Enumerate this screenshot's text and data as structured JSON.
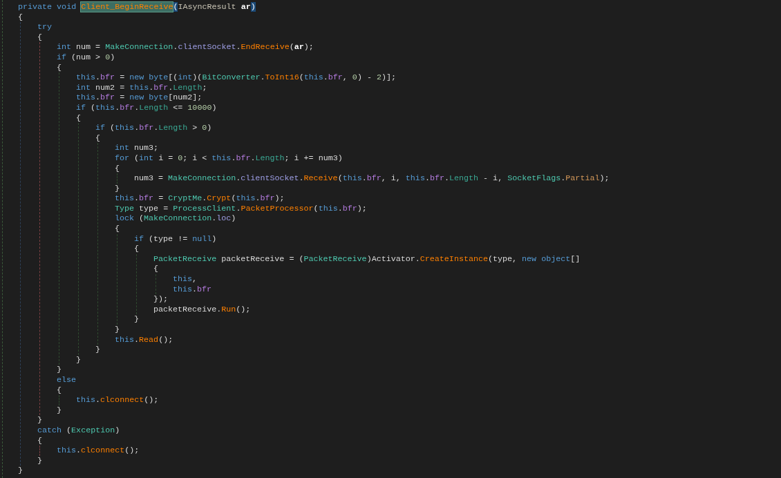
{
  "editor": {
    "code": [
      {
        "kind": "line",
        "tokens": [
          {
            "kind": "kw",
            "text": "private void "
          },
          {
            "kind": "hl",
            "text": "Client_BeginReceive"
          },
          {
            "kind": "match",
            "text": "("
          },
          {
            "kind": "iface",
            "text": "IAsyncResult "
          },
          {
            "kind": "param",
            "text": "ar"
          },
          {
            "kind": "match",
            "text": ")"
          }
        ]
      },
      {
        "kind": "line",
        "tokens": [
          {
            "kind": "plain",
            "text": "{"
          }
        ]
      },
      {
        "kind": "block",
        "children": [
          {
            "kind": "line",
            "tokens": [
              {
                "kind": "kw",
                "text": "try"
              }
            ]
          },
          {
            "kind": "line",
            "tokens": [
              {
                "kind": "plain",
                "text": "{"
              }
            ]
          },
          {
            "kind": "block",
            "children": [
              {
                "kind": "line",
                "tokens": [
                  {
                    "kind": "kw",
                    "text": "int "
                  },
                  {
                    "kind": "plain",
                    "text": "num = "
                  },
                  {
                    "kind": "type",
                    "text": "MakeConnection"
                  },
                  {
                    "kind": "plain",
                    "text": "."
                  },
                  {
                    "kind": "member",
                    "text": "clientSocket"
                  },
                  {
                    "kind": "plain",
                    "text": "."
                  },
                  {
                    "kind": "method",
                    "text": "EndReceive"
                  },
                  {
                    "kind": "plain",
                    "text": "("
                  },
                  {
                    "kind": "param",
                    "text": "ar"
                  },
                  {
                    "kind": "plain",
                    "text": ");"
                  }
                ]
              },
              {
                "kind": "line",
                "tokens": [
                  {
                    "kind": "kw",
                    "text": "if "
                  },
                  {
                    "kind": "plain",
                    "text": "(num > "
                  },
                  {
                    "kind": "num",
                    "text": "0"
                  },
                  {
                    "kind": "plain",
                    "text": ")"
                  }
                ]
              },
              {
                "kind": "line",
                "tokens": [
                  {
                    "kind": "plain",
                    "text": "{"
                  }
                ]
              },
              {
                "kind": "block",
                "children": [
                  {
                    "kind": "line",
                    "tokens": [
                      {
                        "kind": "kw",
                        "text": "this"
                      },
                      {
                        "kind": "plain",
                        "text": "."
                      },
                      {
                        "kind": "field",
                        "text": "bfr"
                      },
                      {
                        "kind": "plain",
                        "text": " = "
                      },
                      {
                        "kind": "kw",
                        "text": "new byte"
                      },
                      {
                        "kind": "plain",
                        "text": "[("
                      },
                      {
                        "kind": "kw",
                        "text": "int"
                      },
                      {
                        "kind": "plain",
                        "text": ")("
                      },
                      {
                        "kind": "type",
                        "text": "BitConverter"
                      },
                      {
                        "kind": "plain",
                        "text": "."
                      },
                      {
                        "kind": "method",
                        "text": "ToInt16"
                      },
                      {
                        "kind": "plain",
                        "text": "("
                      },
                      {
                        "kind": "kw",
                        "text": "this"
                      },
                      {
                        "kind": "plain",
                        "text": "."
                      },
                      {
                        "kind": "field",
                        "text": "bfr"
                      },
                      {
                        "kind": "plain",
                        "text": ", "
                      },
                      {
                        "kind": "num",
                        "text": "0"
                      },
                      {
                        "kind": "plain",
                        "text": ") - "
                      },
                      {
                        "kind": "num",
                        "text": "2"
                      },
                      {
                        "kind": "plain",
                        "text": ")];"
                      }
                    ]
                  },
                  {
                    "kind": "line",
                    "tokens": [
                      {
                        "kind": "kw",
                        "text": "int "
                      },
                      {
                        "kind": "plain",
                        "text": "num2 = "
                      },
                      {
                        "kind": "kw",
                        "text": "this"
                      },
                      {
                        "kind": "plain",
                        "text": "."
                      },
                      {
                        "kind": "field",
                        "text": "bfr"
                      },
                      {
                        "kind": "plain",
                        "text": "."
                      },
                      {
                        "kind": "prop",
                        "text": "Length"
                      },
                      {
                        "kind": "plain",
                        "text": ";"
                      }
                    ]
                  },
                  {
                    "kind": "line",
                    "tokens": [
                      {
                        "kind": "kw",
                        "text": "this"
                      },
                      {
                        "kind": "plain",
                        "text": "."
                      },
                      {
                        "kind": "field",
                        "text": "bfr"
                      },
                      {
                        "kind": "plain",
                        "text": " = "
                      },
                      {
                        "kind": "kw",
                        "text": "new byte"
                      },
                      {
                        "kind": "plain",
                        "text": "[num2];"
                      }
                    ]
                  },
                  {
                    "kind": "line",
                    "tokens": [
                      {
                        "kind": "kw",
                        "text": "if "
                      },
                      {
                        "kind": "plain",
                        "text": "("
                      },
                      {
                        "kind": "kw",
                        "text": "this"
                      },
                      {
                        "kind": "plain",
                        "text": "."
                      },
                      {
                        "kind": "field",
                        "text": "bfr"
                      },
                      {
                        "kind": "plain",
                        "text": "."
                      },
                      {
                        "kind": "prop",
                        "text": "Length"
                      },
                      {
                        "kind": "plain",
                        "text": " <= "
                      },
                      {
                        "kind": "num",
                        "text": "10000"
                      },
                      {
                        "kind": "plain",
                        "text": ")"
                      }
                    ]
                  },
                  {
                    "kind": "line",
                    "tokens": [
                      {
                        "kind": "plain",
                        "text": "{"
                      }
                    ]
                  },
                  {
                    "kind": "block",
                    "children": [
                      {
                        "kind": "line",
                        "tokens": [
                          {
                            "kind": "kw",
                            "text": "if "
                          },
                          {
                            "kind": "plain",
                            "text": "("
                          },
                          {
                            "kind": "kw",
                            "text": "this"
                          },
                          {
                            "kind": "plain",
                            "text": "."
                          },
                          {
                            "kind": "field",
                            "text": "bfr"
                          },
                          {
                            "kind": "plain",
                            "text": "."
                          },
                          {
                            "kind": "prop",
                            "text": "Length"
                          },
                          {
                            "kind": "plain",
                            "text": " > "
                          },
                          {
                            "kind": "num",
                            "text": "0"
                          },
                          {
                            "kind": "plain",
                            "text": ")"
                          }
                        ]
                      },
                      {
                        "kind": "line",
                        "tokens": [
                          {
                            "kind": "plain",
                            "text": "{"
                          }
                        ]
                      },
                      {
                        "kind": "block",
                        "children": [
                          {
                            "kind": "line",
                            "tokens": [
                              {
                                "kind": "kw",
                                "text": "int "
                              },
                              {
                                "kind": "plain",
                                "text": "num3;"
                              }
                            ]
                          },
                          {
                            "kind": "line",
                            "tokens": [
                              {
                                "kind": "kw",
                                "text": "for "
                              },
                              {
                                "kind": "plain",
                                "text": "("
                              },
                              {
                                "kind": "kw",
                                "text": "int "
                              },
                              {
                                "kind": "plain",
                                "text": "i = "
                              },
                              {
                                "kind": "num",
                                "text": "0"
                              },
                              {
                                "kind": "plain",
                                "text": "; i < "
                              },
                              {
                                "kind": "kw",
                                "text": "this"
                              },
                              {
                                "kind": "plain",
                                "text": "."
                              },
                              {
                                "kind": "field",
                                "text": "bfr"
                              },
                              {
                                "kind": "plain",
                                "text": "."
                              },
                              {
                                "kind": "prop",
                                "text": "Length"
                              },
                              {
                                "kind": "plain",
                                "text": "; i += num3)"
                              }
                            ]
                          },
                          {
                            "kind": "line",
                            "tokens": [
                              {
                                "kind": "plain",
                                "text": "{"
                              }
                            ]
                          },
                          {
                            "kind": "block",
                            "children": [
                              {
                                "kind": "line",
                                "tokens": [
                                  {
                                    "kind": "plain",
                                    "text": "num3 = "
                                  },
                                  {
                                    "kind": "type",
                                    "text": "MakeConnection"
                                  },
                                  {
                                    "kind": "plain",
                                    "text": "."
                                  },
                                  {
                                    "kind": "member",
                                    "text": "clientSocket"
                                  },
                                  {
                                    "kind": "plain",
                                    "text": "."
                                  },
                                  {
                                    "kind": "method",
                                    "text": "Receive"
                                  },
                                  {
                                    "kind": "plain",
                                    "text": "("
                                  },
                                  {
                                    "kind": "kw",
                                    "text": "this"
                                  },
                                  {
                                    "kind": "plain",
                                    "text": "."
                                  },
                                  {
                                    "kind": "field",
                                    "text": "bfr"
                                  },
                                  {
                                    "kind": "plain",
                                    "text": ", i, "
                                  },
                                  {
                                    "kind": "kw",
                                    "text": "this"
                                  },
                                  {
                                    "kind": "plain",
                                    "text": "."
                                  },
                                  {
                                    "kind": "field",
                                    "text": "bfr"
                                  },
                                  {
                                    "kind": "plain",
                                    "text": "."
                                  },
                                  {
                                    "kind": "prop",
                                    "text": "Length"
                                  },
                                  {
                                    "kind": "plain",
                                    "text": " - i, "
                                  },
                                  {
                                    "kind": "type",
                                    "text": "SocketFlags"
                                  },
                                  {
                                    "kind": "plain",
                                    "text": "."
                                  },
                                  {
                                    "kind": "enum",
                                    "text": "Partial"
                                  },
                                  {
                                    "kind": "plain",
                                    "text": ");"
                                  }
                                ]
                              }
                            ]
                          },
                          {
                            "kind": "line",
                            "tokens": [
                              {
                                "kind": "plain",
                                "text": "}"
                              }
                            ]
                          },
                          {
                            "kind": "line",
                            "tokens": [
                              {
                                "kind": "kw",
                                "text": "this"
                              },
                              {
                                "kind": "plain",
                                "text": "."
                              },
                              {
                                "kind": "field",
                                "text": "bfr"
                              },
                              {
                                "kind": "plain",
                                "text": " = "
                              },
                              {
                                "kind": "type",
                                "text": "CryptMe"
                              },
                              {
                                "kind": "plain",
                                "text": "."
                              },
                              {
                                "kind": "method",
                                "text": "Crypt"
                              },
                              {
                                "kind": "plain",
                                "text": "("
                              },
                              {
                                "kind": "kw",
                                "text": "this"
                              },
                              {
                                "kind": "plain",
                                "text": "."
                              },
                              {
                                "kind": "field",
                                "text": "bfr"
                              },
                              {
                                "kind": "plain",
                                "text": ");"
                              }
                            ]
                          },
                          {
                            "kind": "line",
                            "tokens": [
                              {
                                "kind": "type",
                                "text": "Type "
                              },
                              {
                                "kind": "plain",
                                "text": "type = "
                              },
                              {
                                "kind": "type",
                                "text": "ProcessClient"
                              },
                              {
                                "kind": "plain",
                                "text": "."
                              },
                              {
                                "kind": "method",
                                "text": "PacketProcessor"
                              },
                              {
                                "kind": "plain",
                                "text": "("
                              },
                              {
                                "kind": "kw",
                                "text": "this"
                              },
                              {
                                "kind": "plain",
                                "text": "."
                              },
                              {
                                "kind": "field",
                                "text": "bfr"
                              },
                              {
                                "kind": "plain",
                                "text": ");"
                              }
                            ]
                          },
                          {
                            "kind": "line",
                            "tokens": [
                              {
                                "kind": "kw",
                                "text": "lock "
                              },
                              {
                                "kind": "plain",
                                "text": "("
                              },
                              {
                                "kind": "type",
                                "text": "MakeConnection"
                              },
                              {
                                "kind": "plain",
                                "text": "."
                              },
                              {
                                "kind": "member",
                                "text": "loc"
                              },
                              {
                                "kind": "plain",
                                "text": ")"
                              }
                            ]
                          },
                          {
                            "kind": "line",
                            "tokens": [
                              {
                                "kind": "plain",
                                "text": "{"
                              }
                            ]
                          },
                          {
                            "kind": "block",
                            "children": [
                              {
                                "kind": "line",
                                "tokens": [
                                  {
                                    "kind": "kw",
                                    "text": "if "
                                  },
                                  {
                                    "kind": "plain",
                                    "text": "(type != "
                                  },
                                  {
                                    "kind": "kw",
                                    "text": "null"
                                  },
                                  {
                                    "kind": "plain",
                                    "text": ")"
                                  }
                                ]
                              },
                              {
                                "kind": "line",
                                "tokens": [
                                  {
                                    "kind": "plain",
                                    "text": "{"
                                  }
                                ]
                              },
                              {
                                "kind": "block",
                                "children": [
                                  {
                                    "kind": "line",
                                    "tokens": [
                                      {
                                        "kind": "type",
                                        "text": "PacketReceive"
                                      },
                                      {
                                        "kind": "plain",
                                        "text": " packetReceive = ("
                                      },
                                      {
                                        "kind": "type",
                                        "text": "PacketReceive"
                                      },
                                      {
                                        "kind": "plain",
                                        "text": ")Activator."
                                      },
                                      {
                                        "kind": "method",
                                        "text": "CreateInstance"
                                      },
                                      {
                                        "kind": "plain",
                                        "text": "(type, "
                                      },
                                      {
                                        "kind": "kw",
                                        "text": "new object"
                                      },
                                      {
                                        "kind": "plain",
                                        "text": "[]"
                                      }
                                    ]
                                  },
                                  {
                                    "kind": "line",
                                    "tokens": [
                                      {
                                        "kind": "plain",
                                        "text": "{"
                                      }
                                    ]
                                  },
                                  {
                                    "kind": "block",
                                    "children": [
                                      {
                                        "kind": "line",
                                        "tokens": [
                                          {
                                            "kind": "kw",
                                            "text": "this"
                                          },
                                          {
                                            "kind": "plain",
                                            "text": ","
                                          }
                                        ]
                                      },
                                      {
                                        "kind": "line",
                                        "tokens": [
                                          {
                                            "kind": "kw",
                                            "text": "this"
                                          },
                                          {
                                            "kind": "plain",
                                            "text": "."
                                          },
                                          {
                                            "kind": "field",
                                            "text": "bfr"
                                          }
                                        ]
                                      }
                                    ]
                                  },
                                  {
                                    "kind": "line",
                                    "tokens": [
                                      {
                                        "kind": "plain",
                                        "text": "});"
                                      }
                                    ]
                                  },
                                  {
                                    "kind": "line",
                                    "tokens": [
                                      {
                                        "kind": "plain",
                                        "text": "packetReceive."
                                      },
                                      {
                                        "kind": "method",
                                        "text": "Run"
                                      },
                                      {
                                        "kind": "plain",
                                        "text": "();"
                                      }
                                    ]
                                  }
                                ]
                              },
                              {
                                "kind": "line",
                                "tokens": [
                                  {
                                    "kind": "plain",
                                    "text": "}"
                                  }
                                ]
                              }
                            ]
                          },
                          {
                            "kind": "line",
                            "tokens": [
                              {
                                "kind": "plain",
                                "text": "}"
                              }
                            ]
                          },
                          {
                            "kind": "line",
                            "tokens": [
                              {
                                "kind": "kw",
                                "text": "this"
                              },
                              {
                                "kind": "plain",
                                "text": "."
                              },
                              {
                                "kind": "method",
                                "text": "Read"
                              },
                              {
                                "kind": "plain",
                                "text": "();"
                              }
                            ]
                          }
                        ]
                      },
                      {
                        "kind": "line",
                        "tokens": [
                          {
                            "kind": "plain",
                            "text": "}"
                          }
                        ]
                      }
                    ]
                  },
                  {
                    "kind": "line",
                    "tokens": [
                      {
                        "kind": "plain",
                        "text": "}"
                      }
                    ]
                  }
                ]
              },
              {
                "kind": "line",
                "tokens": [
                  {
                    "kind": "plain",
                    "text": "}"
                  }
                ]
              },
              {
                "kind": "line",
                "tokens": [
                  {
                    "kind": "kw",
                    "text": "else"
                  }
                ]
              },
              {
                "kind": "line",
                "tokens": [
                  {
                    "kind": "plain",
                    "text": "{"
                  }
                ]
              },
              {
                "kind": "block",
                "children": [
                  {
                    "kind": "line",
                    "tokens": [
                      {
                        "kind": "kw",
                        "text": "this"
                      },
                      {
                        "kind": "plain",
                        "text": "."
                      },
                      {
                        "kind": "method",
                        "text": "clconnect"
                      },
                      {
                        "kind": "plain",
                        "text": "();"
                      }
                    ]
                  }
                ]
              },
              {
                "kind": "line",
                "tokens": [
                  {
                    "kind": "plain",
                    "text": "}"
                  }
                ]
              }
            ]
          },
          {
            "kind": "line",
            "tokens": [
              {
                "kind": "plain",
                "text": "}"
              }
            ]
          },
          {
            "kind": "line",
            "tokens": [
              {
                "kind": "kw",
                "text": "catch "
              },
              {
                "kind": "plain",
                "text": "("
              },
              {
                "kind": "type",
                "text": "Exception"
              },
              {
                "kind": "plain",
                "text": ")"
              }
            ]
          },
          {
            "kind": "line",
            "tokens": [
              {
                "kind": "plain",
                "text": "{"
              }
            ]
          },
          {
            "kind": "block",
            "children": [
              {
                "kind": "line",
                "tokens": [
                  {
                    "kind": "kw",
                    "text": "this"
                  },
                  {
                    "kind": "plain",
                    "text": "."
                  },
                  {
                    "kind": "method",
                    "text": "clconnect"
                  },
                  {
                    "kind": "plain",
                    "text": "();"
                  }
                ]
              }
            ]
          },
          {
            "kind": "line",
            "tokens": [
              {
                "kind": "plain",
                "text": "}"
              }
            ]
          }
        ]
      },
      {
        "kind": "line",
        "tokens": [
          {
            "kind": "plain",
            "text": "}"
          }
        ]
      }
    ]
  }
}
